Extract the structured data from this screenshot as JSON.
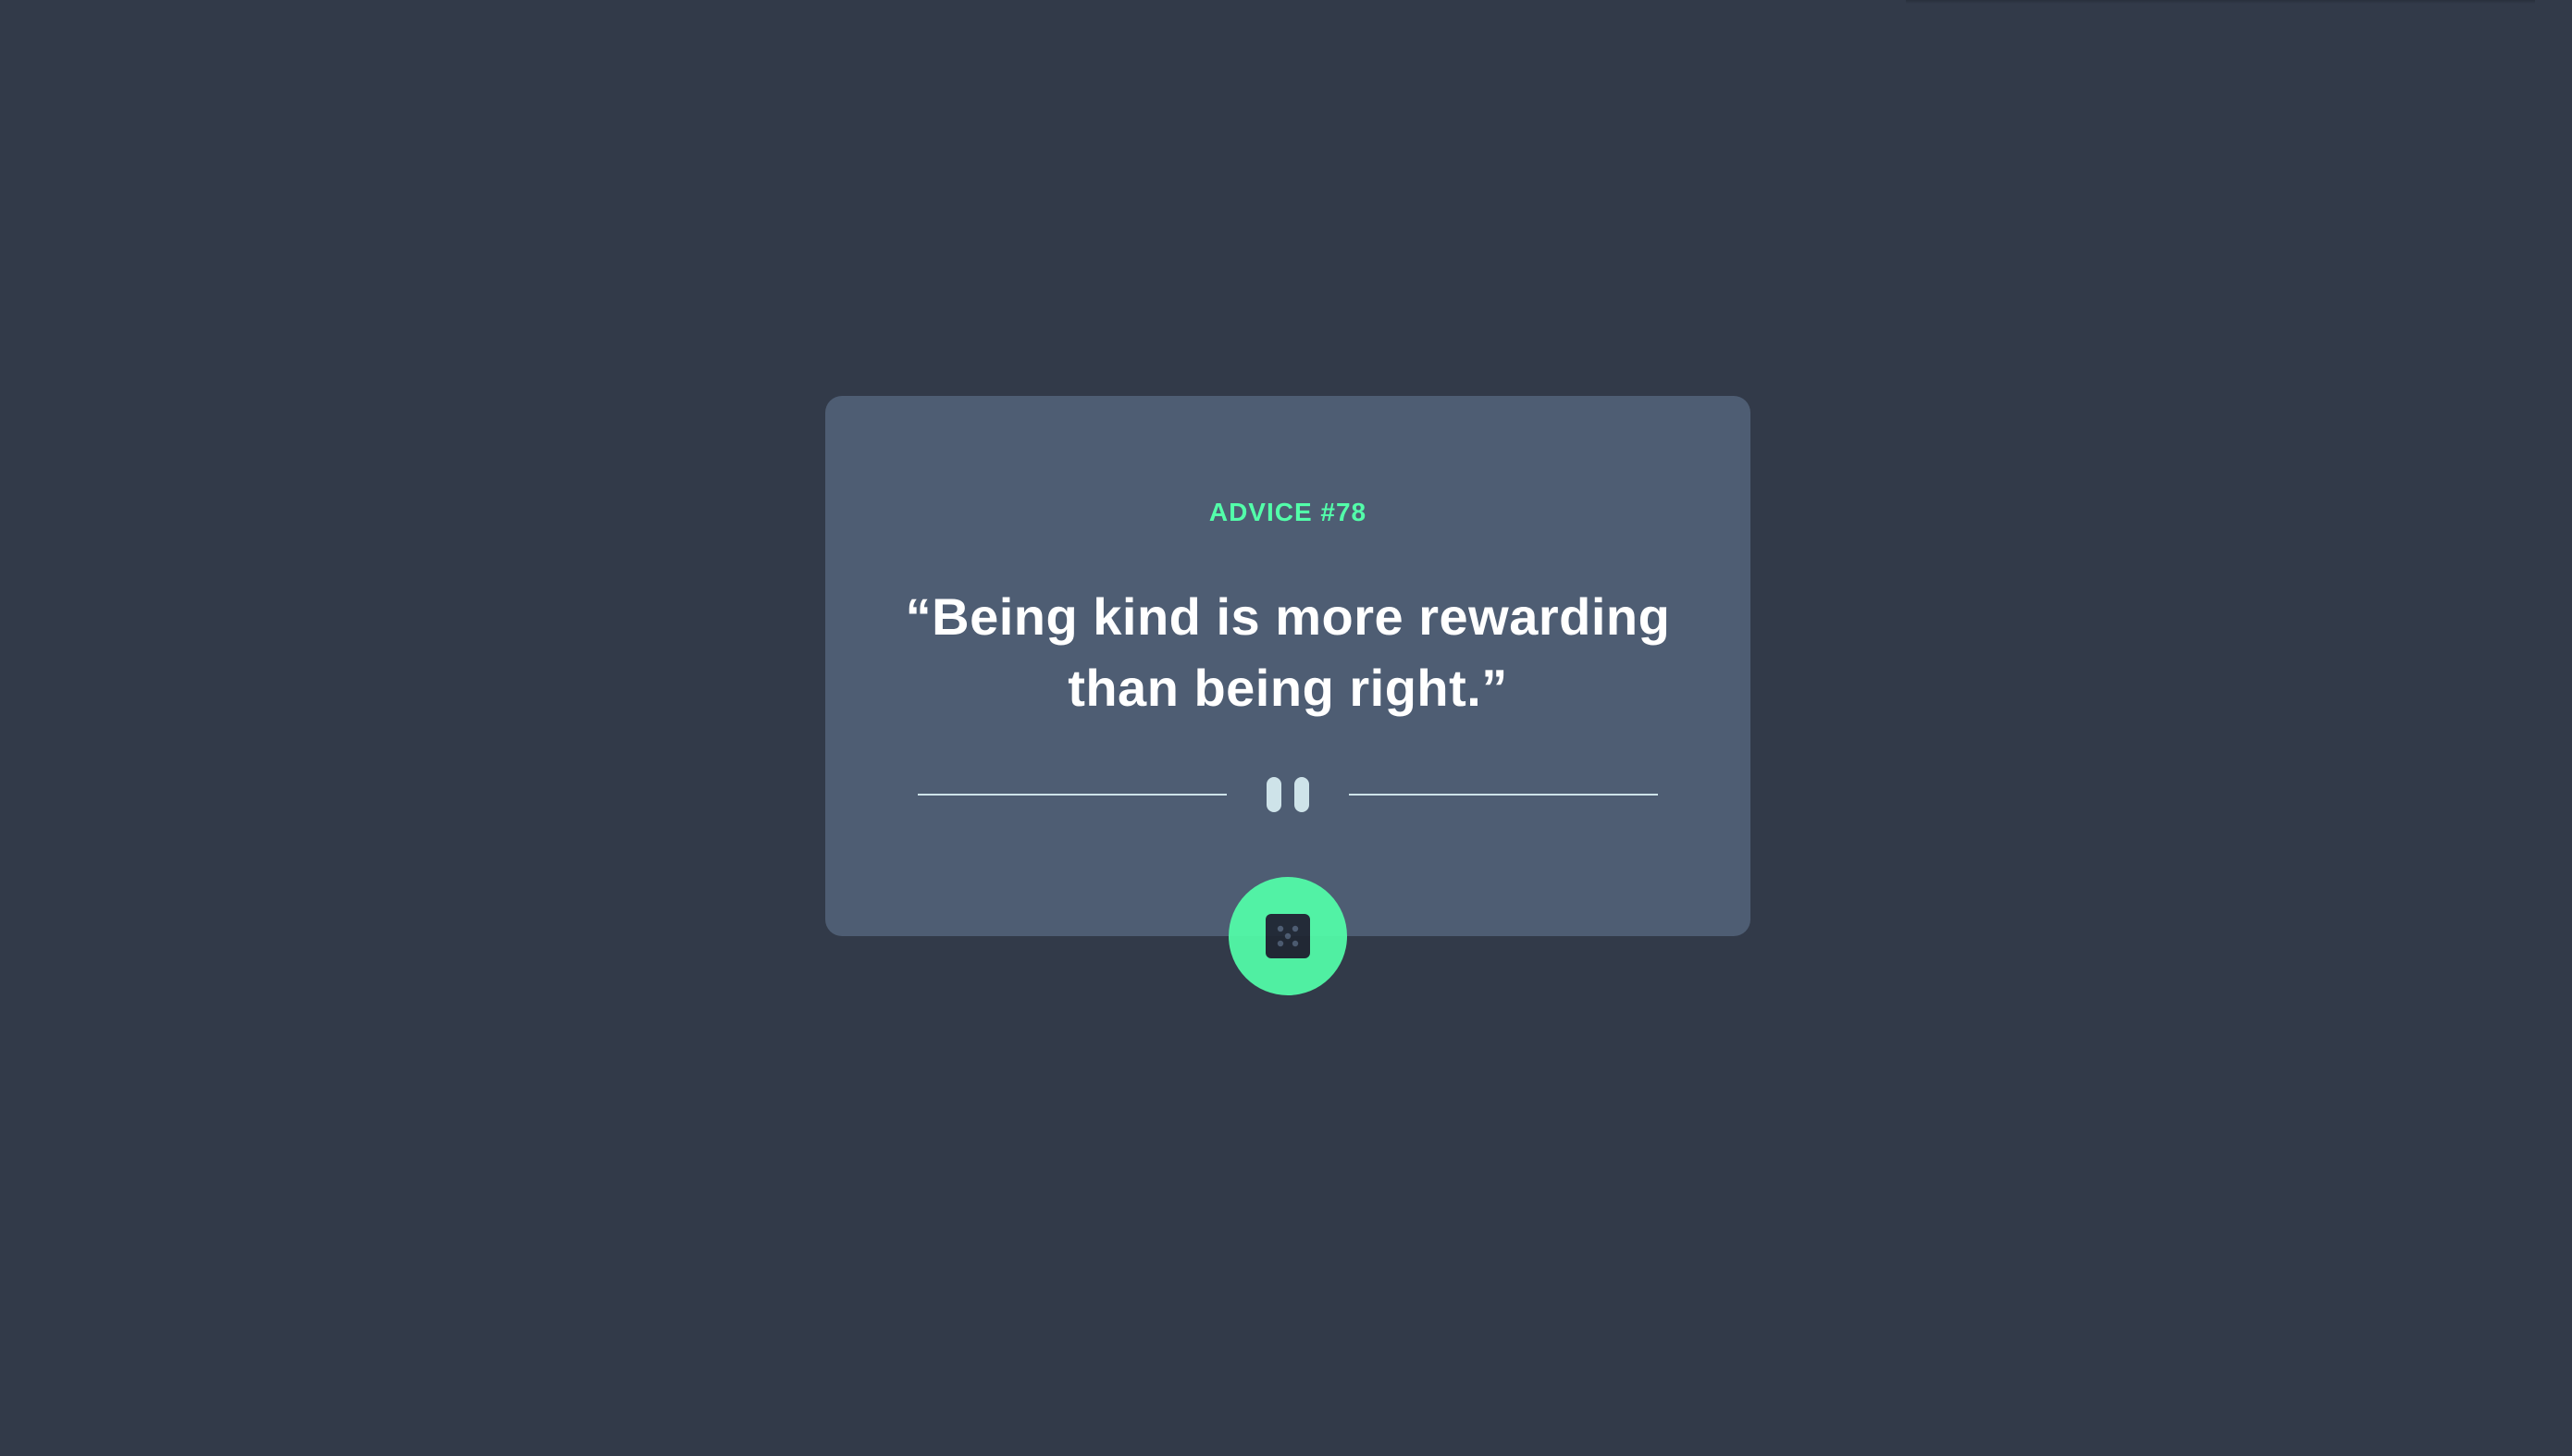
{
  "card": {
    "advice_label": "ADVICE #78",
    "quote": "“Being kind is more rewarding than being right.”"
  },
  "divider": {
    "icon": "pause-icon"
  },
  "dice_button": {
    "icon": "dice-icon"
  },
  "colors": {
    "background": "#323a49",
    "card": "#4e5d73",
    "accent": "#53ffaa",
    "text": "#ffffff",
    "divider": "#cee3e9"
  }
}
